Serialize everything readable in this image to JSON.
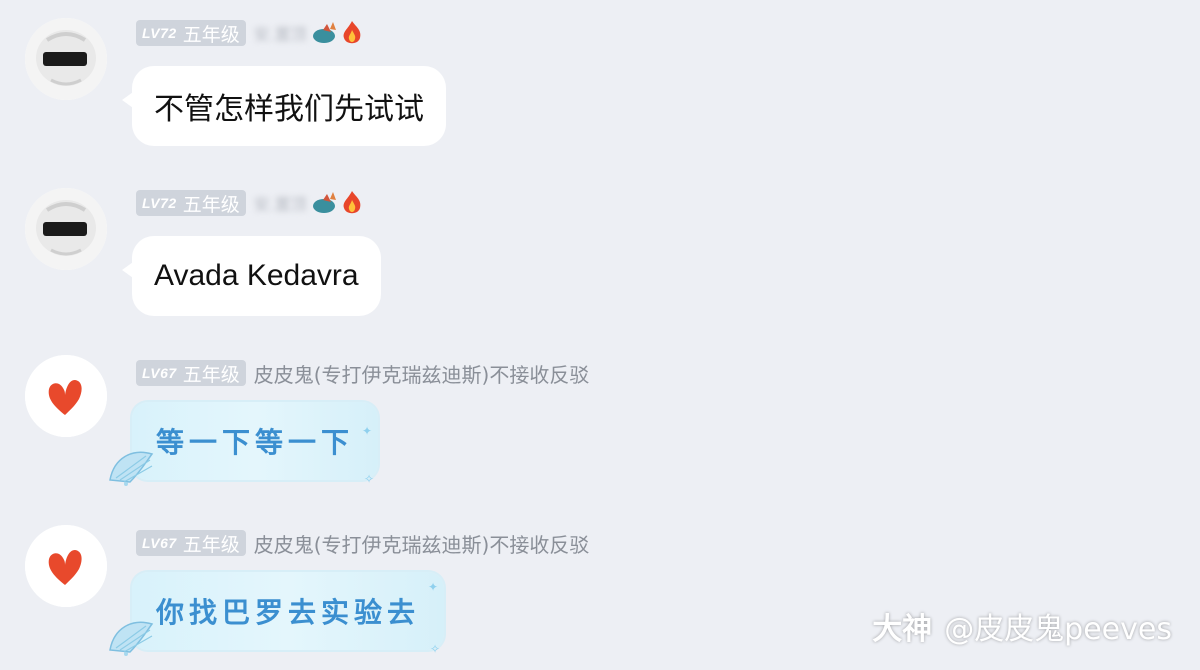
{
  "messages": [
    {
      "level": "LV72",
      "grade": "五年级",
      "nickname": "安.置顶",
      "text": "不管怎样我们先试试"
    },
    {
      "level": "LV72",
      "grade": "五年级",
      "nickname": "安.置顶",
      "text": "Avada Kedavra"
    },
    {
      "level": "LV67",
      "grade": "五年级",
      "nickname": "皮皮鬼(专打伊克瑞兹迪斯)不接收反驳",
      "text": "等一下等一下"
    },
    {
      "level": "LV67",
      "grade": "五年级",
      "nickname": "皮皮鬼(专打伊克瑞兹迪斯)不接收反驳",
      "text": "你找巴罗去实验去"
    }
  ],
  "watermark": {
    "brand": "大神",
    "handle": "@皮皮鬼peeves"
  },
  "icons": {
    "user1_avatar": "masked-face-avatar-icon",
    "user2_avatar": "red-heart-avatar-icon",
    "decor_1": "dragon-icon",
    "decor_2": "fire-icon",
    "bubble_decor": "seashell-icon"
  },
  "colors": {
    "background": "#edeff4",
    "bubble": "#ffffff",
    "badge": "#cfd4dc",
    "fancy_text": "#3b8fd0",
    "heart": "#e8492c"
  }
}
